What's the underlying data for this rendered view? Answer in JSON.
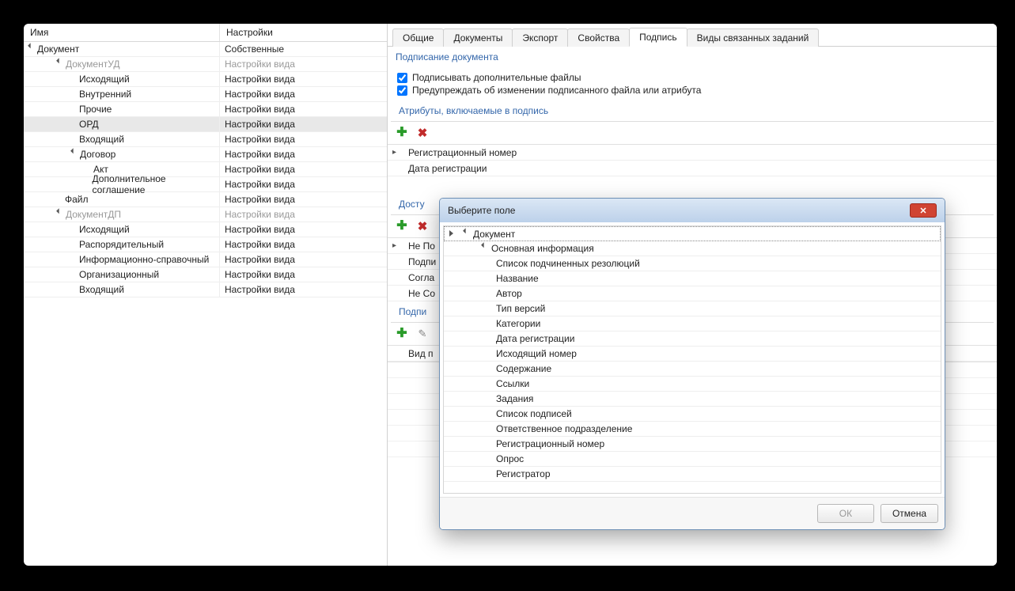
{
  "left": {
    "header_name": "Имя",
    "header_settings": "Настройки",
    "rows": [
      {
        "indent": 0,
        "label": "Документ",
        "settings": "Собственные",
        "expander": "open",
        "muted": false
      },
      {
        "indent": 2,
        "label": "ДокументУД",
        "settings": "Настройки вида",
        "expander": "open",
        "muted": true
      },
      {
        "indent": 3,
        "label": "Исходящий",
        "settings": "Настройки вида",
        "expander": "",
        "muted": false
      },
      {
        "indent": 3,
        "label": "Внутренний",
        "settings": "Настройки вида",
        "expander": "",
        "muted": false
      },
      {
        "indent": 3,
        "label": "Прочие",
        "settings": "Настройки вида",
        "expander": "",
        "muted": false
      },
      {
        "indent": 3,
        "label": "ОРД",
        "settings": "Настройки вида",
        "expander": "",
        "muted": false,
        "selected": true
      },
      {
        "indent": 3,
        "label": "Входящий",
        "settings": "Настройки вида",
        "expander": "",
        "muted": false
      },
      {
        "indent": 3,
        "label": "Договор",
        "settings": "Настройки вида",
        "expander": "open",
        "muted": false
      },
      {
        "indent": 4,
        "label": "Акт",
        "settings": "Настройки вида",
        "expander": "",
        "muted": false
      },
      {
        "indent": 4,
        "label": "Дополнительное соглашение",
        "settings": "Настройки вида",
        "expander": "",
        "muted": false
      },
      {
        "indent": 2,
        "label": "Файл",
        "settings": "Настройки вида",
        "expander": "",
        "muted": false
      },
      {
        "indent": 2,
        "label": "ДокументДП",
        "settings": "Настройки вида",
        "expander": "open",
        "muted": true
      },
      {
        "indent": 3,
        "label": "Исходящий",
        "settings": "Настройки вида",
        "expander": "",
        "muted": false
      },
      {
        "indent": 3,
        "label": "Распорядительный",
        "settings": "Настройки вида",
        "expander": "",
        "muted": false
      },
      {
        "indent": 3,
        "label": "Информационно-справочный",
        "settings": "Настройки вида",
        "expander": "",
        "muted": false
      },
      {
        "indent": 3,
        "label": "Организационный",
        "settings": "Настройки вида",
        "expander": "",
        "muted": false
      },
      {
        "indent": 3,
        "label": "Входящий",
        "settings": "Настройки вида",
        "expander": "",
        "muted": false
      }
    ]
  },
  "tabs": {
    "items": [
      "Общие",
      "Документы",
      "Экспорт",
      "Свойства",
      "Подпись",
      "Виды связанных заданий"
    ],
    "active_index": 4
  },
  "sign": {
    "section_title": "Подписание документа",
    "chk1_label": "Подписывать дополнительные файлы",
    "chk2_label": "Предупреждать об изменении подписанного файла или атрибута",
    "attrs_title": "Атрибуты, включаемые в подпись",
    "attrs": [
      {
        "marker": "▸",
        "label": "Регистрационный номер"
      },
      {
        "marker": "",
        "label": "Дата регистрации"
      }
    ]
  },
  "sections_behind": {
    "avail_title_partial": "Досту",
    "rows_partial": [
      "Не По",
      "Подпи",
      "Согла",
      "Не Со"
    ],
    "sign_rules_partial": "Подпи",
    "kind_partial": "Вид п"
  },
  "dialog": {
    "title": "Выберите поле",
    "root_label": "Документ",
    "group_label": "Основная информация",
    "fields": [
      "Список подчиненных резолюций",
      "Название",
      "Автор",
      "Тип версий",
      "Категории",
      "Дата регистрации",
      "Исходящий номер",
      "Содержание",
      "Ссылки",
      "Задания",
      "Список подписей",
      "Ответственное подразделение",
      "Регистрационный номер",
      "Опрос",
      "Регистратор"
    ],
    "ok_label": "ОК",
    "cancel_label": "Отмена"
  }
}
